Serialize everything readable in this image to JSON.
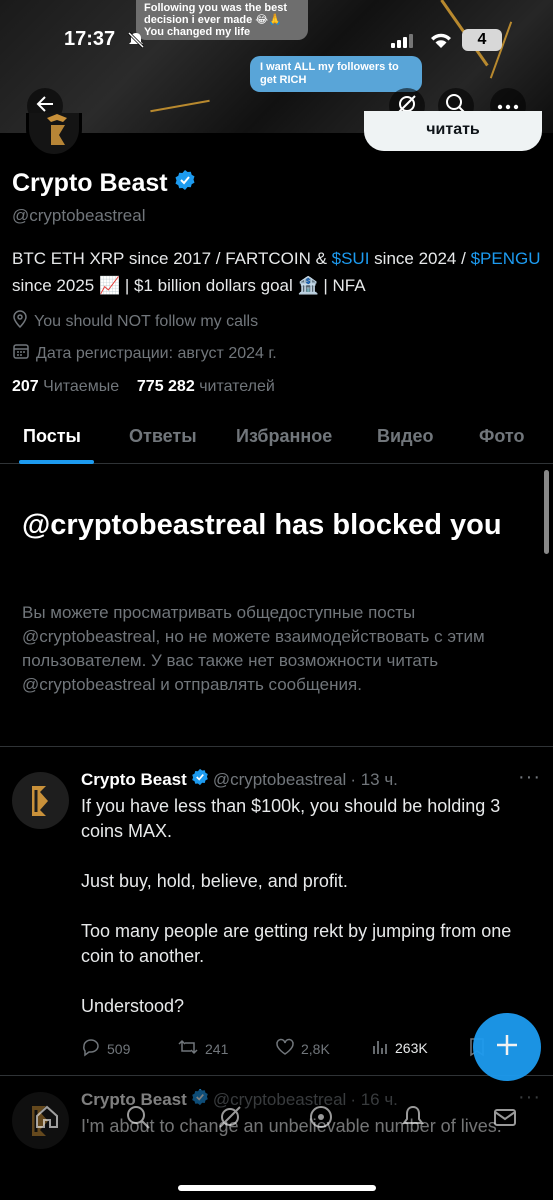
{
  "status": {
    "time": "17:37",
    "battery": "4"
  },
  "banner": {
    "story_text": "Following you was the best decision i ever made 😂🙏 You changed my life",
    "bubble_text": "I want ALL my followers to get RICH"
  },
  "profile": {
    "follow_label": "читать",
    "name": "Crypto Beast",
    "handle": "@cryptobeastreal",
    "bio_part1": "BTC ETH XRP since 2017 / FARTCOIN & ",
    "bio_sui": "$SUI",
    "bio_part2": " since 2024 / ",
    "bio_pengu": "$PENGU",
    "bio_part3": " since 2025 📈 | $1 billion dollars goal 🏦 | NFA",
    "location": "You should NOT follow my calls",
    "joined": "Дата регистрации: август 2024 г.",
    "following_count": "207",
    "following_label": "Читаемые",
    "followers_count": "775 282",
    "followers_label": "читателей"
  },
  "tabs": [
    "Посты",
    "Ответы",
    "Избранное",
    "Видео",
    "Фото"
  ],
  "blocked": {
    "title": "@cryptobeastreal has blocked you",
    "text": "Вы можете просматривать общедоступные посты @cryptobeastreal, но не можете взаимодействовать с этим пользователем. У вас также нет возможности читать @cryptobeastreal и отправлять сообщения."
  },
  "tweets": [
    {
      "name": "Crypto Beast",
      "handle": "@cryptobeastreal",
      "time": "· 13 ч.",
      "lines": [
        "If you have less than $100k, you should be holding 3 coins MAX.",
        "Just buy, hold, believe, and profit.",
        "Too many people are getting rekt by jumping from one coin to another.",
        "Understood?"
      ],
      "replies": "509",
      "reposts": "241",
      "likes": "2,8K",
      "views": "263K"
    },
    {
      "name": "Crypto Beast",
      "handle": "@cryptobeastreal",
      "time": "· 16 ч.",
      "lines": [
        "I'm about to change an unbelievable number of lives."
      ]
    }
  ],
  "colors": {
    "accent": "#1d9bf0",
    "muted": "#71767b",
    "background": "#000000"
  }
}
